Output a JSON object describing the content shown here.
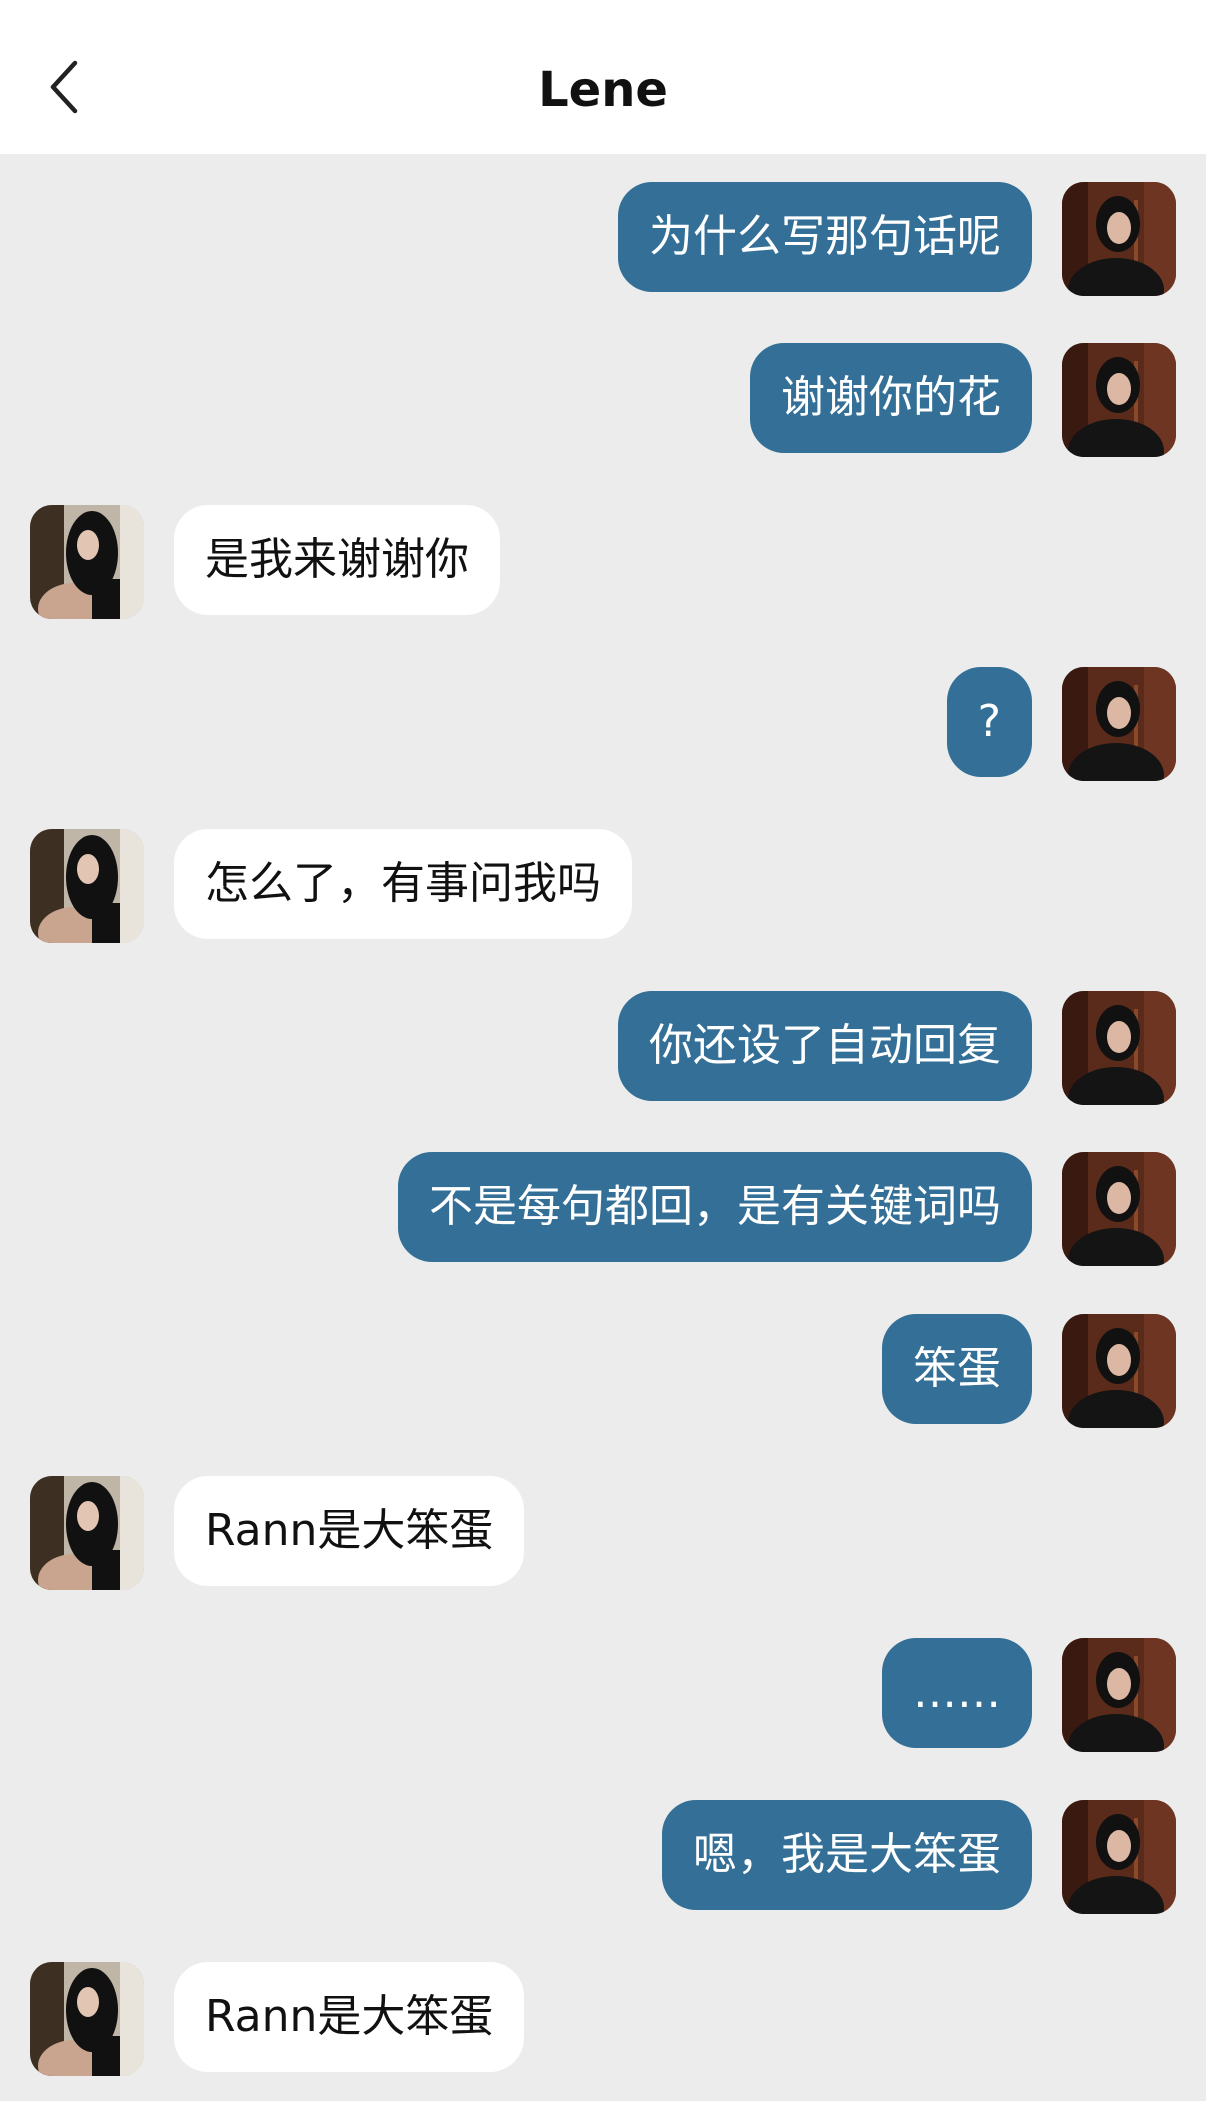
{
  "header": {
    "title": "Lene",
    "back_icon": "chevron-left-icon"
  },
  "colors": {
    "outgoing_bubble": "#336f96",
    "incoming_bubble": "#ffffff",
    "background": "#ececec"
  },
  "messages": [
    {
      "sender": "me",
      "text": "为什么写那句话呢"
    },
    {
      "sender": "me",
      "text": "谢谢你的花"
    },
    {
      "sender": "other",
      "text": "是我来谢谢你"
    },
    {
      "sender": "me",
      "text": "?"
    },
    {
      "sender": "other",
      "text": "怎么了，有事问我吗"
    },
    {
      "sender": "me",
      "text": "你还设了自动回复"
    },
    {
      "sender": "me",
      "text": "不是每句都回，是有关键词吗"
    },
    {
      "sender": "me",
      "text": "笨蛋"
    },
    {
      "sender": "other",
      "text": "Rann是大笨蛋"
    },
    {
      "sender": "me",
      "text": "……"
    },
    {
      "sender": "me",
      "text": "嗯，我是大笨蛋"
    },
    {
      "sender": "other",
      "text": "Rann是大笨蛋"
    }
  ]
}
